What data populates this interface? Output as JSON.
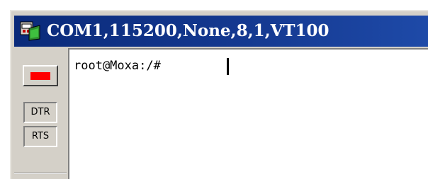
{
  "window": {
    "title": "COM1,115200,None,8,1,VT100",
    "icon": "serial-terminal-app-icon"
  },
  "side_panel": {
    "led_color": "#ff0000",
    "dtr_label": "DTR",
    "rts_label": "RTS"
  },
  "terminal": {
    "prompt": "root@Moxa:/# "
  },
  "colors": {
    "titlebar": "#0a2a7a",
    "panel": "#d4d0c8",
    "led": "#ff0000"
  }
}
